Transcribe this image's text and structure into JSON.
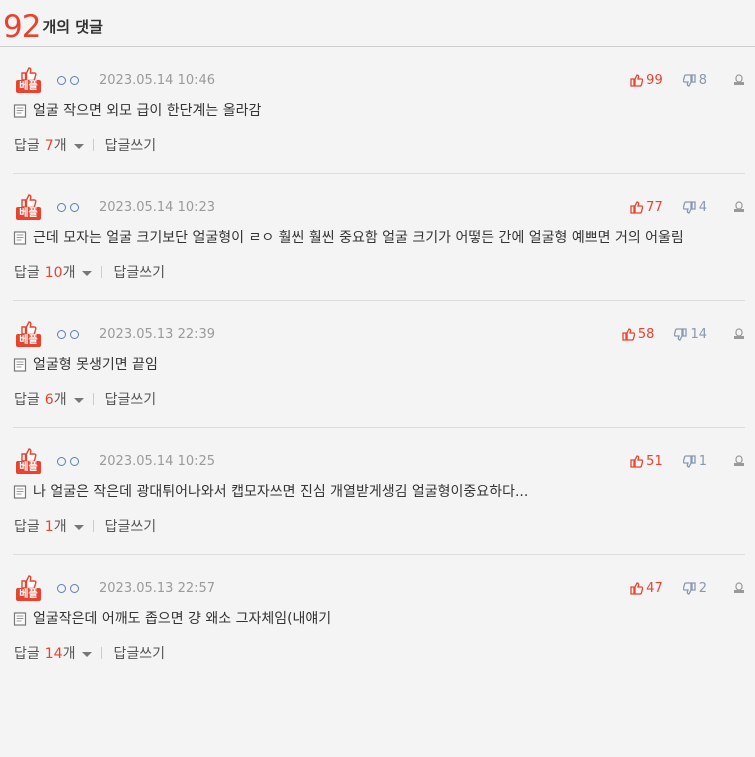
{
  "header": {
    "count": "92",
    "label": "개의 댓글"
  },
  "badge_label": "베플",
  "reply_label": "답글",
  "reply_unit": "개",
  "write_label": "답글쓰기",
  "colors": {
    "accent": "#e8432e",
    "down": "#8898b0"
  },
  "comments": [
    {
      "date": "2023.05.14 10:46",
      "up": "99",
      "down": "8",
      "text": "얼굴 작으면 외모 급이 한단계는 올라감",
      "replies": "7"
    },
    {
      "date": "2023.05.14 10:23",
      "up": "77",
      "down": "4",
      "text": "근데 모자는 얼굴 크기보단 얼굴형이 ㄹㅇ 훨씬 훨씬 중요함 얼굴 크기가 어떻든 간에 얼굴형 예쁘면 거의 어울림",
      "replies": "10"
    },
    {
      "date": "2023.05.13 22:39",
      "up": "58",
      "down": "14",
      "text": "얼굴형 못생기면 끝임",
      "replies": "6"
    },
    {
      "date": "2023.05.14 10:25",
      "up": "51",
      "down": "1",
      "text": "나 얼굴은 작은데 광대튀어나와서 캡모자쓰면 진심 개열받게생김 얼굴형이중요하다...",
      "replies": "1"
    },
    {
      "date": "2023.05.13 22:57",
      "up": "47",
      "down": "2",
      "text": "얼굴작은데 어깨도 좁으면 걍 왜소 그자체임(내얘기",
      "replies": "14"
    }
  ]
}
